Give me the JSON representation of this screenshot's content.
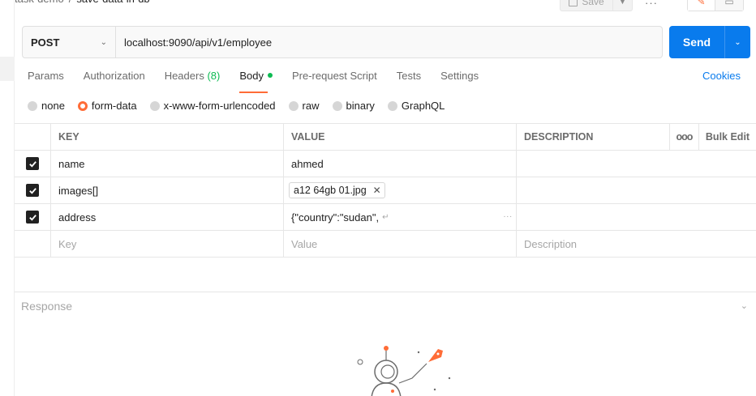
{
  "header": {
    "breadcrumb_parent": "task-demo",
    "breadcrumb_separator": "/",
    "breadcrumb_current": "save-data-in-db",
    "save_label": "Save",
    "more_label": "···"
  },
  "request": {
    "method": "POST",
    "url": "localhost:9090/api/v1/employee",
    "send_label": "Send"
  },
  "tabs": [
    {
      "label": "Params"
    },
    {
      "label": "Authorization"
    },
    {
      "label": "Headers",
      "count": "(8)"
    },
    {
      "label": "Body"
    },
    {
      "label": "Pre-request Script"
    },
    {
      "label": "Tests"
    },
    {
      "label": "Settings"
    }
  ],
  "cookies_label": "Cookies",
  "body_types": [
    {
      "label": "none"
    },
    {
      "label": "form-data"
    },
    {
      "label": "x-www-form-urlencoded"
    },
    {
      "label": "raw"
    },
    {
      "label": "binary"
    },
    {
      "label": "GraphQL"
    }
  ],
  "body_type_selected": "form-data",
  "table": {
    "headers": {
      "key": "KEY",
      "value": "VALUE",
      "description": "DESCRIPTION",
      "more": "ooo",
      "bulk_edit": "Bulk Edit"
    },
    "rows": [
      {
        "key": "name",
        "value": "ahmed",
        "description": "",
        "checked": true,
        "type": "text"
      },
      {
        "key": "images[]",
        "value": "a12 64gb 01.jpg",
        "description": "",
        "checked": true,
        "type": "file"
      },
      {
        "key": "address",
        "value": "{\"country\":\"sudan\",",
        "description": "",
        "checked": true,
        "type": "text",
        "multiline": true
      }
    ],
    "placeholders": {
      "key": "Key",
      "value": "Value",
      "description": "Description"
    }
  },
  "response": {
    "title": "Response"
  },
  "colors": {
    "accent": "#ff6c37",
    "primary": "#097bed",
    "success": "#0cbb52"
  }
}
